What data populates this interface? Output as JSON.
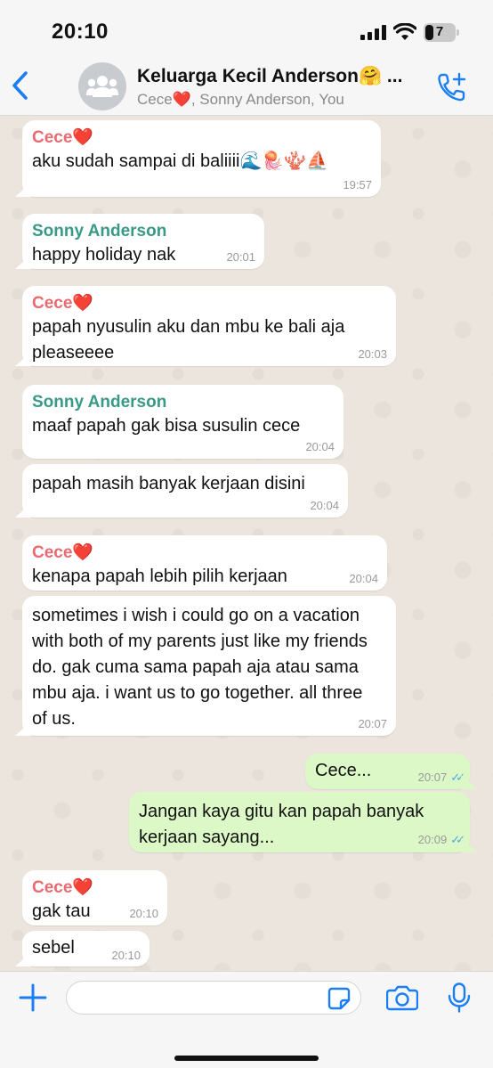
{
  "status_bar": {
    "time": "20:10",
    "battery_level": "7",
    "icons": [
      "cellular-signal-icon",
      "wifi-icon",
      "battery-icon"
    ]
  },
  "header": {
    "title": "Keluarga Kecil Anderson🤗 ...",
    "members": "Cece❤️, Sonny Anderson, You",
    "back_icon": "chevron-left-icon",
    "avatar_icon": "group-people-icon",
    "call_icon": "add-call-icon"
  },
  "messages": [
    {
      "sender": "Cece❤️",
      "text": "aku sudah sampai di baliiii🌊🪼🪸⛵",
      "time": "19:57"
    },
    {
      "sender": "Sonny Anderson",
      "text": "happy holiday nak",
      "time": "20:01"
    },
    {
      "sender": "Cece❤️",
      "text": "papah nyusulin aku dan mbu ke bali aja pleaseeee",
      "time": "20:03"
    },
    {
      "sender": "Sonny Anderson",
      "text": "maaf papah gak bisa susulin cece",
      "time": "20:04"
    },
    {
      "sender": "",
      "text": "papah masih banyak kerjaan disini",
      "time": "20:04"
    },
    {
      "sender": "Cece❤️",
      "text": "kenapa papah lebih pilih kerjaan",
      "time": "20:04"
    },
    {
      "sender": "",
      "text": "sometimes i wish i could go on a vacation with both of my parents just like my friends do. gak cuma sama papah aja atau sama mbu aja. i want us to go together. all three of us.",
      "time": "20:07"
    },
    {
      "sender": "You",
      "text": "Cece...",
      "time": "20:07",
      "status": "read"
    },
    {
      "sender": "You",
      "text": "Jangan kaya gitu kan papah banyak kerjaan sayang...",
      "time": "20:09",
      "status": "read"
    },
    {
      "sender": "Cece❤️",
      "text": "gak tau",
      "time": "20:10"
    },
    {
      "sender": "",
      "text": "sebel",
      "time": "20:10"
    }
  ],
  "input_bar": {
    "placeholder": "",
    "icons": [
      "plus-icon",
      "sticker-icon",
      "camera-icon",
      "microphone-icon"
    ]
  },
  "colors": {
    "accent": "#1a7ef5",
    "incoming_bubble": "#ffffff",
    "outgoing_bubble": "#dcf8c6",
    "cece_name": "#e86b71",
    "sonny_name": "#3a9a87",
    "chat_background": "#ece5dd",
    "read_ticks": "#4fa8e0"
  }
}
